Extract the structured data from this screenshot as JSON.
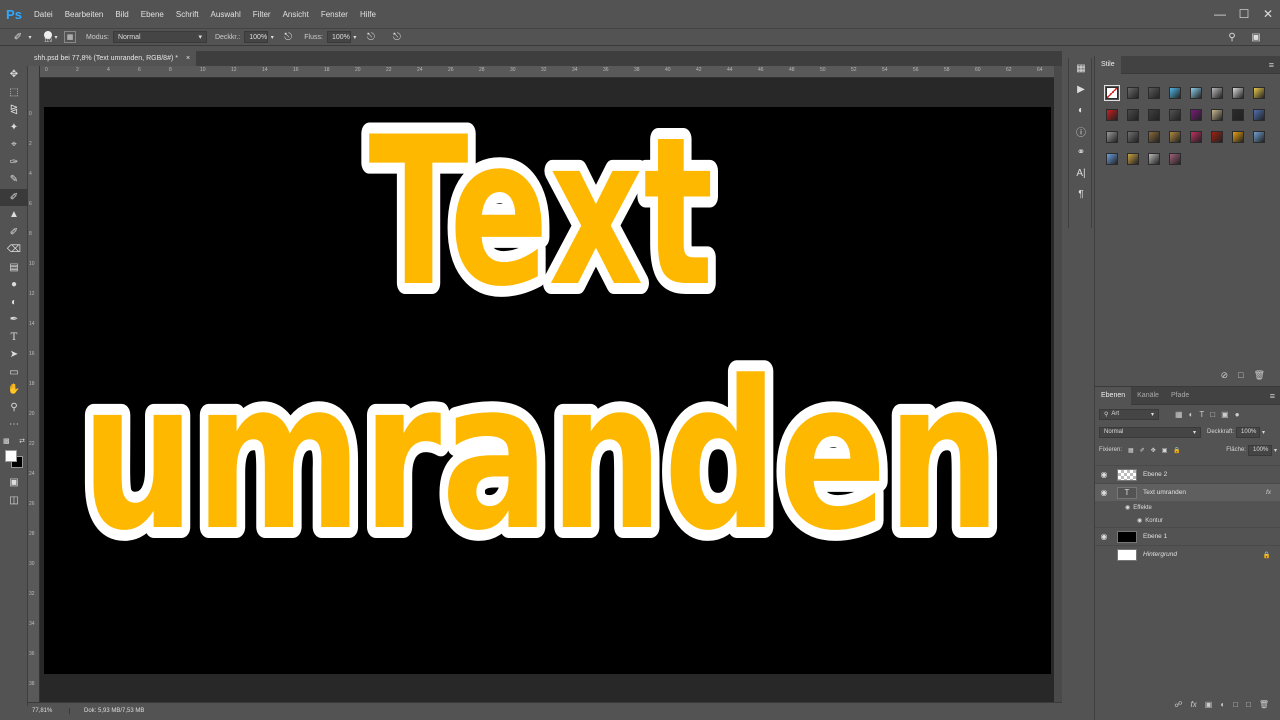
{
  "app": {
    "logo": "Ps",
    "menu": [
      "Datei",
      "Bearbeiten",
      "Bild",
      "Ebene",
      "Schrift",
      "Auswahl",
      "Filter",
      "Ansicht",
      "Fenster",
      "Hilfe"
    ],
    "window_controls": [
      "minimize-icon",
      "maximize-icon",
      "close-icon"
    ]
  },
  "options": {
    "brush_size": "119",
    "mode_label": "Modus:",
    "mode_value": "Normal",
    "opacity_label": "Deckkr.:",
    "opacity_value": "100%",
    "flow_label": "Fluss:",
    "flow_value": "100%"
  },
  "document": {
    "tab_title": "shh.psd bei 77,8% (Text umranden, RGB/8#) *",
    "close": "×",
    "zoom": "77,81%",
    "doc_size": "Dok: 5,93 MB/7,53 MB"
  },
  "rulers": {
    "h_ticks": [
      "0",
      "2",
      "4",
      "6",
      "8",
      "10",
      "12",
      "14",
      "16",
      "18",
      "20",
      "22",
      "24",
      "26",
      "28",
      "30",
      "32",
      "34",
      "36",
      "38",
      "40",
      "42",
      "44",
      "46",
      "48",
      "50",
      "52",
      "54",
      "56",
      "58",
      "60",
      "62",
      "64",
      "66"
    ],
    "v_ticks": [
      "0",
      "2",
      "4",
      "6",
      "8",
      "10",
      "12",
      "14",
      "16",
      "18",
      "20",
      "22",
      "24",
      "26",
      "28",
      "30",
      "32",
      "34",
      "36",
      "38"
    ]
  },
  "canvas_text": {
    "line1": "Text",
    "line2": "umranden",
    "fill_color": "#ffb800",
    "stroke_color": "#ffffff",
    "background": "#000000"
  },
  "tools": [
    "move-icon",
    "marquee-icon",
    "lasso-icon",
    "magic-wand-icon",
    "crop-icon",
    "eyedropper-icon",
    "healing-brush-icon",
    "brush-icon",
    "clone-stamp-icon",
    "history-brush-icon",
    "eraser-icon",
    "gradient-icon",
    "blur-icon",
    "dodge-icon",
    "pen-icon",
    "type-icon",
    "path-selection-icon",
    "shape-icon",
    "hand-icon",
    "zoom-icon",
    "more-tools-icon"
  ],
  "styles_panel": {
    "tab": "Stile",
    "swatches": [
      "#ffffff",
      "#6a6a6a",
      "#5a5a5a",
      "#4fb6e6",
      "#8ad0ec",
      "#b8b8b8",
      "#d9d9d9",
      "#e8c84a",
      "#c81e1e",
      "#4a4a4a",
      "#3e3e3e",
      "#525252",
      "#7a1a7a",
      "#c8b890",
      "#2a2a2a",
      "#5070b0",
      "#9a9a9a",
      "#707070",
      "#8a6a3a",
      "#b08840",
      "#c03060",
      "#a02010",
      "#e8a010",
      "#70a0d0",
      "#6aa0e0",
      "#c8a040",
      "#b8b8b8",
      "#a0607a"
    ]
  },
  "layers_panel": {
    "tabs": [
      "Ebenen",
      "Kanäle",
      "Pfade"
    ],
    "filter": "Art",
    "blend": "Normal",
    "opacity_label": "Deckkraft:",
    "opacity_value": "100%",
    "lock_label": "Fixieren:",
    "fill_label": "Fläche:",
    "fill_value": "100%",
    "layers": [
      {
        "name": "Ebene 2"
      },
      {
        "name": "Text umranden",
        "fx": "fx"
      },
      {
        "name": "Effekte"
      },
      {
        "name": "Kontur"
      },
      {
        "name": "Ebene 1"
      },
      {
        "name": "Hintergrund"
      }
    ]
  }
}
